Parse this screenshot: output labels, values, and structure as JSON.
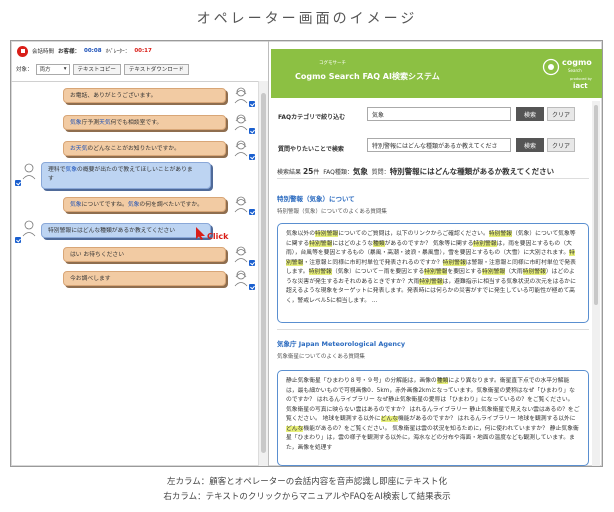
{
  "page_title": "オペレーター画面のイメージ",
  "left": {
    "call_label": "会話時間",
    "customer_label": "お客様：",
    "customer_time": "00:08",
    "operator_label": "ｵﾍﾟﾚｰﾀｰ：",
    "operator_time": "00:17",
    "target_label": "対象：",
    "target_select": "両方",
    "copy_button": "テキストコピー",
    "download_button": "テキストダウンロード",
    "messages": [
      {
        "speaker": "operator",
        "parts": [
          "お電話、ありがとうございます。"
        ]
      },
      {
        "speaker": "operator",
        "parts": [
          "",
          "気象",
          "庁予測",
          "天気",
          "何でも相談室です。"
        ]
      },
      {
        "speaker": "operator",
        "parts": [
          "",
          "お天気",
          "のどんなことがお知りたいですか。"
        ]
      },
      {
        "speaker": "customer",
        "parts": [
          "理科で",
          "気象",
          "の概要が出たので教えてほしいことがありま",
          "",
          "す"
        ]
      },
      {
        "speaker": "operator",
        "parts": [
          "",
          "気象",
          "についてですね。",
          "気象",
          "の何を調べたいですか。"
        ]
      },
      {
        "speaker": "customer",
        "parts": [
          "特別警報にはどんな種類があるか教えてください"
        ]
      },
      {
        "speaker": "operator",
        "parts": [
          "はい お待ちください"
        ]
      },
      {
        "speaker": "operator",
        "parts": [
          "今お調べします"
        ]
      }
    ],
    "click_label": "Click"
  },
  "right": {
    "banner_small": "コグモサーチ",
    "banner_title": "Cogmo Search  FAQ AI検索システム",
    "logo_word": "cogmo",
    "logo_sub": "Search",
    "logo_by": "produced by",
    "logo_iact": "iact",
    "faq_category_label": "FAQカテゴリで絞り込む",
    "faq_category_value": "気象",
    "search_button_1": "検索",
    "clear_button_1": "クリア",
    "question_label": "質問やりたいことで検索",
    "question_value": "特別警報にはどんな種類があるか教えてくださ",
    "search_button_2": "検索",
    "clear_button_2": "クリア",
    "result_count_label": "検索結果",
    "result_count": "25",
    "result_count_unit": "件",
    "faq_cat_label": "FAQ種類：",
    "faq_cat_value": "気象",
    "query_label": "質問：",
    "query_value": "特別警報にはどんな種類があるか教えてください",
    "results": [
      {
        "title": "特別警報（気象）について",
        "subtitle": "特別警報（気象）についてのよくある質問集",
        "body": "気象以外の特別警報についてのご質問は，以下のリンクからご確認ください。特別警報（気象）について気象等に関する特別警報にはどのような種類があるのですか？ 気象等に関する特別警報は，雨を要因とするもの（大雨），台風等を要因とするもの（暴風・高潮・波浪・暴風雪），雪を要因とするもの（大雪）に大別されます。特別警報・注意報と同様に市町村単位で発表されるのですか？特別警報は警報・注意報と同様に市町村単位で発表します。特別警報（気象）について－雨を要因とする特別警報を要因とする特別警報（大雨特別警報）はどのような災害が発生するおそれのあるときですか？大雨特別警報は，避難指示に相当する気象状況の次元をはるかに超えるような現象をターゲットに発表します。発表時には何らかの災害がすでに発生している可能性が極めて高く，警戒レベル5に相当します。 ..."
      },
      {
        "title": "気象庁 Japan Meteorological Agency",
        "subtitle": "気象衛星についてのよくある質問集",
        "body": "静止気象衛星「ひまわり８号・９号」の分解能は，画像の種類により異なります。衛星直下点での水平分解能は，最も細かいもので可視画像0．5km，赤外画像2kmとなっています。気象衛星の愛称はなぜ「ひまわり」なのですか？ はれるんライブラリー なぜ静止気象衛星の愛称は「ひまわり」になっているの？をご覧ください。 気象衛星の写真に映らない雲はあるのですか？ はれるんライブラリー 静止気象衛星で見えない雲はあるの？をご覧ください。 地球を観測する以外にどんな機能があるのですか？ はれるんライブラリー 地球を観測する以外にどんな機能があるの？をご覧ください。 気象衛星は雲の状況を知るために，何に使われていますか？ 静止気象衛星「ひまわり」は，雲の様子を観測する以外に，海水などの分布や海面・地面の温度なども観測しています。また，画像を処理す"
      }
    ]
  },
  "captions": [
    "左カラム：顧客とオペレーターの会話内容を音声認識し即座にテキスト化",
    "右カラム：テキストのクリックからマニュアルやFAQをAI検索して結果表示"
  ],
  "colors": {
    "accent_green": "#8cc043",
    "operator_bubble": "#f2cba3",
    "customer_bubble": "#bdd4f2",
    "link_blue": "#2a6abf",
    "alert_red": "#d91e18"
  }
}
